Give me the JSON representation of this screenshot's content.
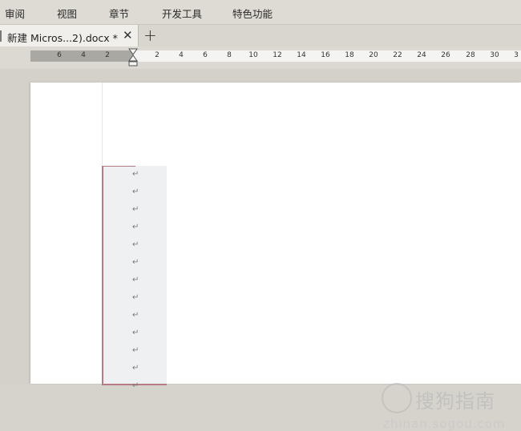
{
  "menubar": {
    "items": [
      "审阅",
      "视图",
      "章节",
      "开发工具",
      "特色功能"
    ]
  },
  "tabs": {
    "document_title": "新建 Micros...2).docx *",
    "close_glyph": "✕",
    "new_tab_glyph": "+"
  },
  "ruler": {
    "left_numbers": [
      "6",
      "4",
      "2"
    ],
    "right_numbers": [
      "2",
      "4",
      "6",
      "8",
      "10",
      "12",
      "14",
      "16",
      "18",
      "20",
      "22",
      "24",
      "26",
      "28",
      "30",
      "3"
    ]
  },
  "document": {
    "paragraph_mark": "↵",
    "paragraph_count": 13
  },
  "watermark": {
    "brand": "搜狗指南",
    "url": "zhinan.sogou.com"
  },
  "icons": {
    "indent": "indent-marker-icon",
    "close": "close-icon",
    "add": "plus-icon",
    "logo": "sogou-logo-icon"
  }
}
